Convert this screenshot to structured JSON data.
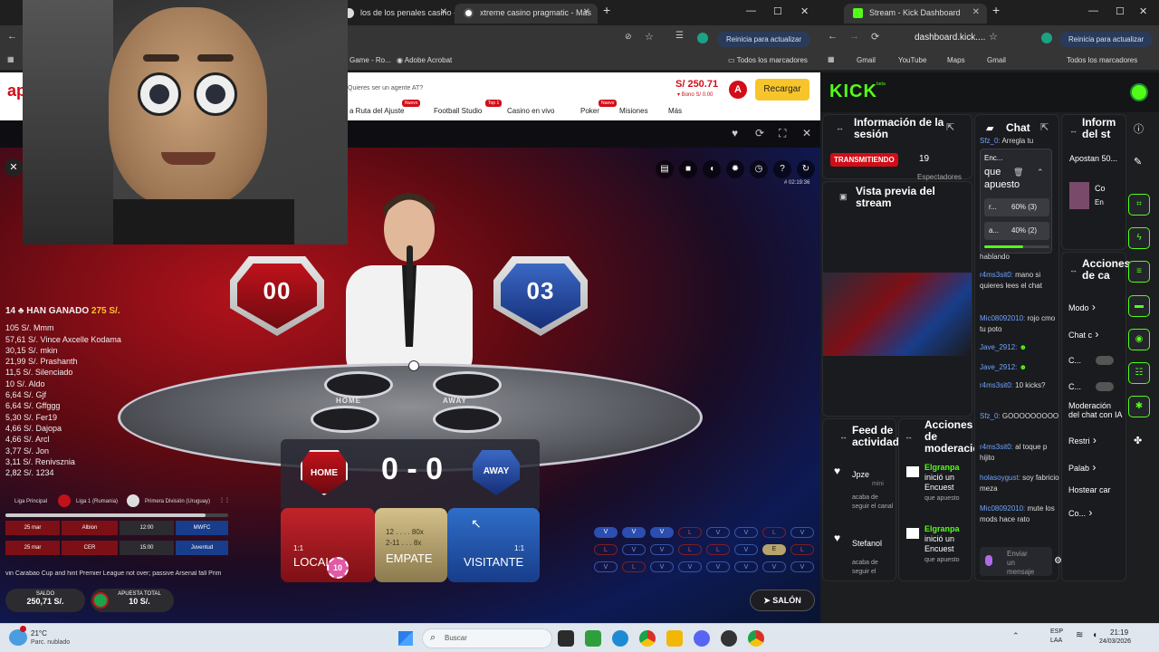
{
  "left_browser": {
    "tabs": [
      {
        "title": "los de los penales casino - M"
      },
      {
        "title": "xtreme casino pragmatic - Mas"
      }
    ],
    "address_bar": {
      "update_button": "Reinicia para actualizar"
    },
    "bookmarks": [
      {
        "label": "Game - Ro..."
      },
      {
        "label": "Adobe Acrobat"
      },
      {
        "label": "Todos los marcadores"
      }
    ]
  },
  "casino_header": {
    "logo_fragment": "ap",
    "agent_text": "Quieres ser un agente AT?",
    "balance": "S/ 250.71",
    "bonus": "Bono S/ 0.00",
    "avatar_letter": "A",
    "recharge_button": "Recargar",
    "nav": [
      {
        "label": "a Ruta del Ajuste",
        "badge": "Nuevo"
      },
      {
        "label": "Football Studio",
        "badge": "Top 1"
      },
      {
        "label": "Casino en vivo",
        "badge": ""
      },
      {
        "label": "Poker",
        "badge": "Nuevo"
      },
      {
        "label": "Misiones",
        "badge": ""
      },
      {
        "label": "Más",
        "badge": ""
      }
    ]
  },
  "game": {
    "timestamp": "# 02:19:36",
    "home_number": "00",
    "away_number": "03",
    "home_label": "HOME",
    "away_label": "AWAY",
    "score": "0 - 0",
    "winners_header": "14",
    "winners_title": "HAN GANADO",
    "winners_amount": "275 S/.",
    "winners": [
      "105 S/. Mmm",
      "57,61 S/. Vince Axcelle Kodama",
      "30,15 S/. mkin",
      "21,99 S/. Prashanth",
      "11,5 S/. Silenciado",
      "10 S/. Aldo",
      "6,64 S/. Gjf",
      "6,64 S/. Gffggg",
      "5,30 S/. Fer19",
      "4,66 S/. Dajopa",
      "4,66 S/. Arcl",
      "3,77 S/. Jon",
      "3,11 S/. Renivsznia",
      "2,82 S/. 1234"
    ],
    "leagues": [
      "Liga Principal",
      "Liga 1 (Rumania)",
      "Primera División (Uruguay)"
    ],
    "schedule": [
      {
        "date": "25 mar",
        "home": "Albion",
        "time": "12:00",
        "away": "MWFC"
      },
      {
        "date": "25 mar",
        "home": "CER",
        "time": "15:00",
        "away": "Juventud"
      }
    ],
    "ticker": "vin Carabao Cup and hint Premier League not over; passive Arsenal fall   Prim",
    "bets": {
      "local": {
        "label": "LOCAL",
        "odds": "1:1"
      },
      "empate": {
        "label": "EMPATE",
        "line1": "12 . . . . 80x",
        "line2": "2-11 . . . 8x"
      },
      "visitante": {
        "label": "VISITANTE",
        "odds": "1:1"
      }
    },
    "chip_value": "10",
    "saldo_label": "SALDO",
    "saldo_value": "250,71 S/.",
    "apuesta_label": "APUESTA TOTAL",
    "apuesta_value": "10 S/.",
    "salon_button": "SALÓN",
    "history": [
      [
        "V",
        "V",
        "V",
        "L",
        "V",
        "V",
        "L",
        "V"
      ],
      [
        "L",
        "V",
        "V",
        "L",
        "L",
        "V",
        "E",
        "L"
      ],
      [
        "V",
        "L",
        "V",
        "V",
        "V",
        "V",
        "V",
        "V"
      ]
    ]
  },
  "right_browser": {
    "tab_title": "Stream - Kick Dashboard",
    "url": "dashboard.kick....",
    "update_button": "Reinicia para actualizar",
    "bookmarks": [
      "Gmail",
      "YouTube",
      "Maps",
      "Gmail",
      "Todos los marcadores"
    ],
    "logo": "KICK",
    "logo_sup": "beta",
    "session_title": "Información de la sesión",
    "live_badge": "TRANSMITIENDO",
    "viewer_count": "19",
    "viewers_label": "Espectadores",
    "preview_title": "Vista previa del stream",
    "feed_title": "Feed de actividad",
    "mod_title": "Acciones de moderación",
    "chat_title": "Chat",
    "info_title": "Inform del st",
    "acciones_title": "Acciones de ca",
    "poll": {
      "header": "Enc...",
      "question": "que apuesto",
      "options": [
        {
          "label": "r...",
          "result": "60% (3)"
        },
        {
          "label": "a...",
          "result": "40% (2)"
        }
      ]
    },
    "chat": [
      {
        "user": "Sfz_0:",
        "text": "Arregla tu"
      },
      {
        "user": "",
        "text": "hablando"
      },
      {
        "user": "r4ms3sit0:",
        "text": "mano si quieres lees el chat"
      },
      {
        "user": "Mic08092010:",
        "text": "rojo cmo tu poto"
      },
      {
        "user": "Jave_2912:",
        "text": ""
      },
      {
        "user": "Jave_2912:",
        "text": ""
      },
      {
        "user": "r4ms3sit0:",
        "text": "10 kicks?"
      },
      {
        "user": "Sfz_0:",
        "text": "GOOOOOOOOO"
      },
      {
        "user": "r4ms3sit0:",
        "text": "al toque p hijito"
      },
      {
        "user": "holasoygust:",
        "text": "soy fabricio meza"
      },
      {
        "user": "Mic08092010:",
        "text": "mute los mods hace rato"
      }
    ],
    "chat_placeholder": "Enviar un mensaje",
    "feed": [
      {
        "name": "Jpze",
        "sub": "mini",
        "text": "acaba de seguir el canal"
      },
      {
        "name": "Stefanol",
        "sub": "",
        "text": "acaba de seguir el"
      }
    ],
    "mod_actions": [
      {
        "name": "Elgranpa",
        "text": "inició un Encuest",
        "sub": "que apuesto"
      },
      {
        "name": "Elgranpa",
        "text": "inició un Encuest",
        "sub": "que apuesto"
      }
    ],
    "info_snippet": "Apostan 50...",
    "info_small": [
      "Co",
      "En"
    ],
    "actions": [
      {
        "label": "Modo"
      },
      {
        "label": "Chat c"
      },
      {
        "label": "C..."
      },
      {
        "label": "C..."
      },
      {
        "label": "Moderación del chat con IA"
      },
      {
        "label": "Restri"
      },
      {
        "label": "Palab"
      },
      {
        "label": "Hostear car"
      },
      {
        "label": "Co..."
      }
    ]
  },
  "taskbar": {
    "temp": "21°C",
    "weather": "Parc. nublado",
    "search_placeholder": "Buscar",
    "lang": "ESP",
    "lang2": "LAA",
    "time": "21:19",
    "date": "24/03/2026"
  },
  "colors": {
    "kick_green": "#53fc18",
    "casino_red": "#d10d18",
    "recharge_yellow": "#f7c52b"
  }
}
